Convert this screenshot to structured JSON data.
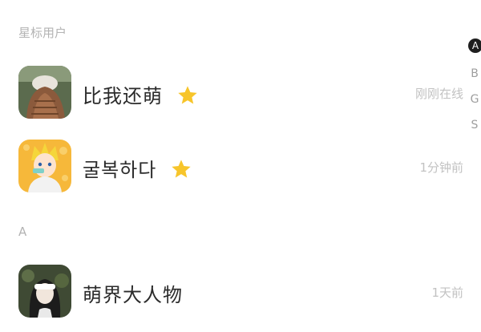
{
  "sections": {
    "starred": "星标用户",
    "a": "A"
  },
  "contacts": [
    {
      "name": "比我还萌",
      "status": "刚刚在线",
      "starred": true
    },
    {
      "name": "굴복하다",
      "status": "1分钟前",
      "starred": true
    },
    {
      "name": "萌界大人物",
      "status": "1天前",
      "starred": false
    }
  ],
  "index_bar": [
    "A",
    "B",
    "G",
    "S"
  ],
  "colors": {
    "star": "#F7C52B",
    "index_active_bg": "#1F1F1F",
    "secondary_text": "#B3B3B3"
  }
}
